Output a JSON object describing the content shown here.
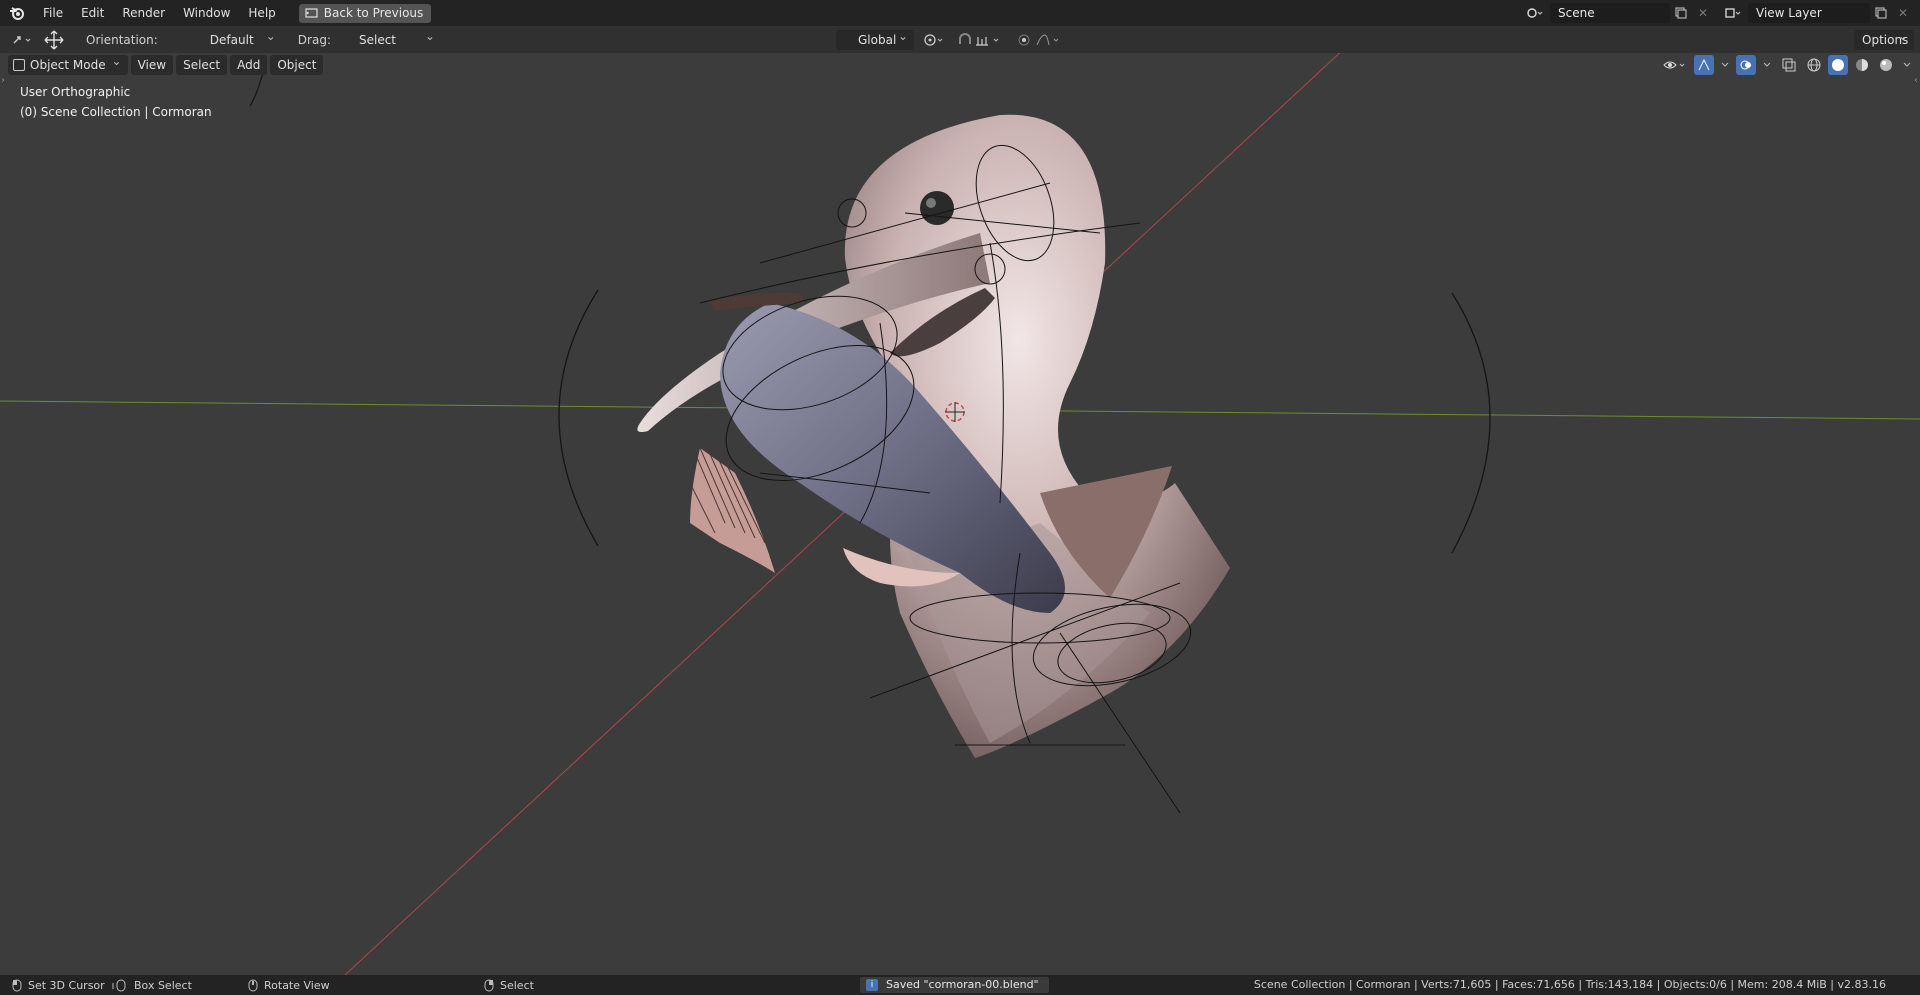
{
  "topbar": {
    "menus": [
      "File",
      "Edit",
      "Render",
      "Window",
      "Help"
    ],
    "back_button": "Back to Previous",
    "scene_name": "Scene",
    "view_layer": "View Layer"
  },
  "toolbar": {
    "orientation_label": "Orientation:",
    "orientation_value": "Default",
    "drag_label": "Drag:",
    "drag_value": "Select Box",
    "transform_orientation": "Global",
    "options_label": "Options"
  },
  "viewport": {
    "mode": "Object Mode",
    "header_menus": [
      "View",
      "Select",
      "Add",
      "Object"
    ],
    "view_name": "User Orthographic",
    "collection_info": "(0) Scene Collection | Cormoran"
  },
  "statusbar": {
    "hint_left": "Set 3D Cursor",
    "hint_middle": "Box Select",
    "hint_rotate": "Rotate View",
    "hint_select": "Select",
    "saved_message": "Saved \"cormoran-00.blend\"",
    "stats": "Scene Collection | Cormoran | Verts:71,605 | Faces:71,656 | Tris:143,184 | Objects:0/6 | Mem: 208.4 MiB | v2.83.16"
  },
  "colors": {
    "accent_blue": "#4772b3",
    "x_axis": "#b0464b",
    "y_axis": "#6a8f2a"
  }
}
